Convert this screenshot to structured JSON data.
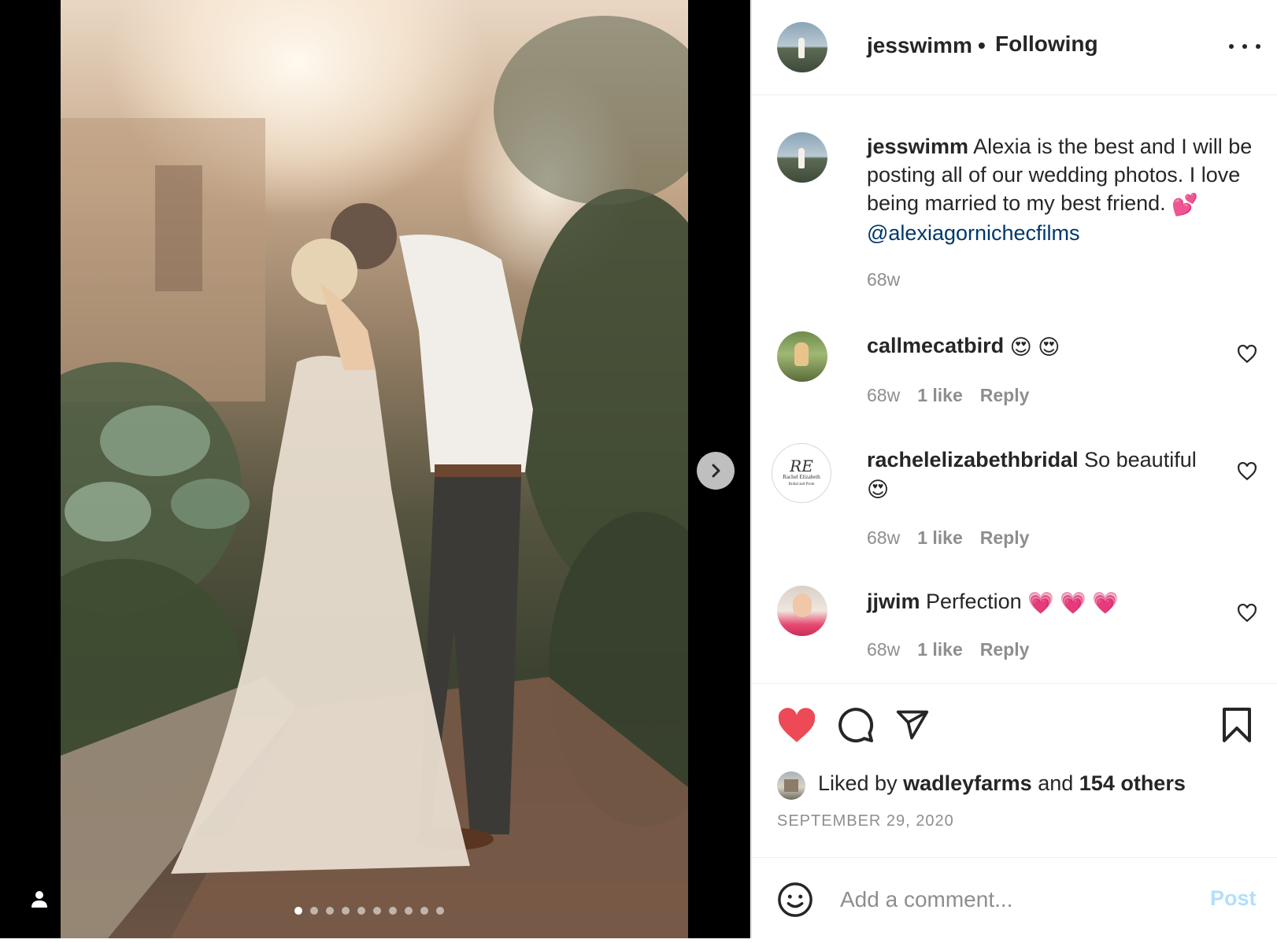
{
  "post": {
    "author": "jesswimm",
    "follow_state": "Following",
    "separator": "•",
    "image_count": 10,
    "active_image_index": 0
  },
  "caption": {
    "username": "jesswimm",
    "text": "Alexia is the best and I will be posting all of our wedding photos. I love being married to my best friend.",
    "emoji": "💕",
    "mention": "@alexiagornichecfilms",
    "time": "68w"
  },
  "comments": [
    {
      "username": "callmecatbird",
      "text": "",
      "emoji": "😍 😍",
      "time": "68w",
      "likes": "1 like",
      "reply": "Reply",
      "avatar": "callmecatbird-avatar"
    },
    {
      "username": "rachelelizabethbridal",
      "text": "So beautiful",
      "emoji": "😍",
      "time": "68w",
      "likes": "1 like",
      "reply": "Reply",
      "avatar": "rachel-elizabeth-logo"
    },
    {
      "username": "jjwim",
      "text": "Perfection",
      "emoji": "💗 💗 💗",
      "time": "68w",
      "likes": "1 like",
      "reply": "Reply",
      "avatar": "jjwim-avatar"
    }
  ],
  "rachel_logo": {
    "monogram": "RE",
    "name": "Rachel Elizabeth",
    "tagline": "Bridal and Prom"
  },
  "likes": {
    "prefix": "Liked by",
    "user": "wadleyfarms",
    "joiner": "and",
    "others": "154 others"
  },
  "date": "SEPTEMBER 29, 2020",
  "comment_box": {
    "placeholder": "Add a comment...",
    "post_label": "Post"
  },
  "colors": {
    "heart_red": "#ed4956",
    "mention_blue": "#00376b",
    "post_disabled": "#b2dffc",
    "muted": "#8e8e8e"
  },
  "icons": [
    "more-options-icon",
    "heart-filled-icon",
    "comment-icon",
    "share-icon",
    "bookmark-icon",
    "emoji-icon",
    "chevron-right-icon",
    "user-tag-icon",
    "heart-outline-icon"
  ]
}
